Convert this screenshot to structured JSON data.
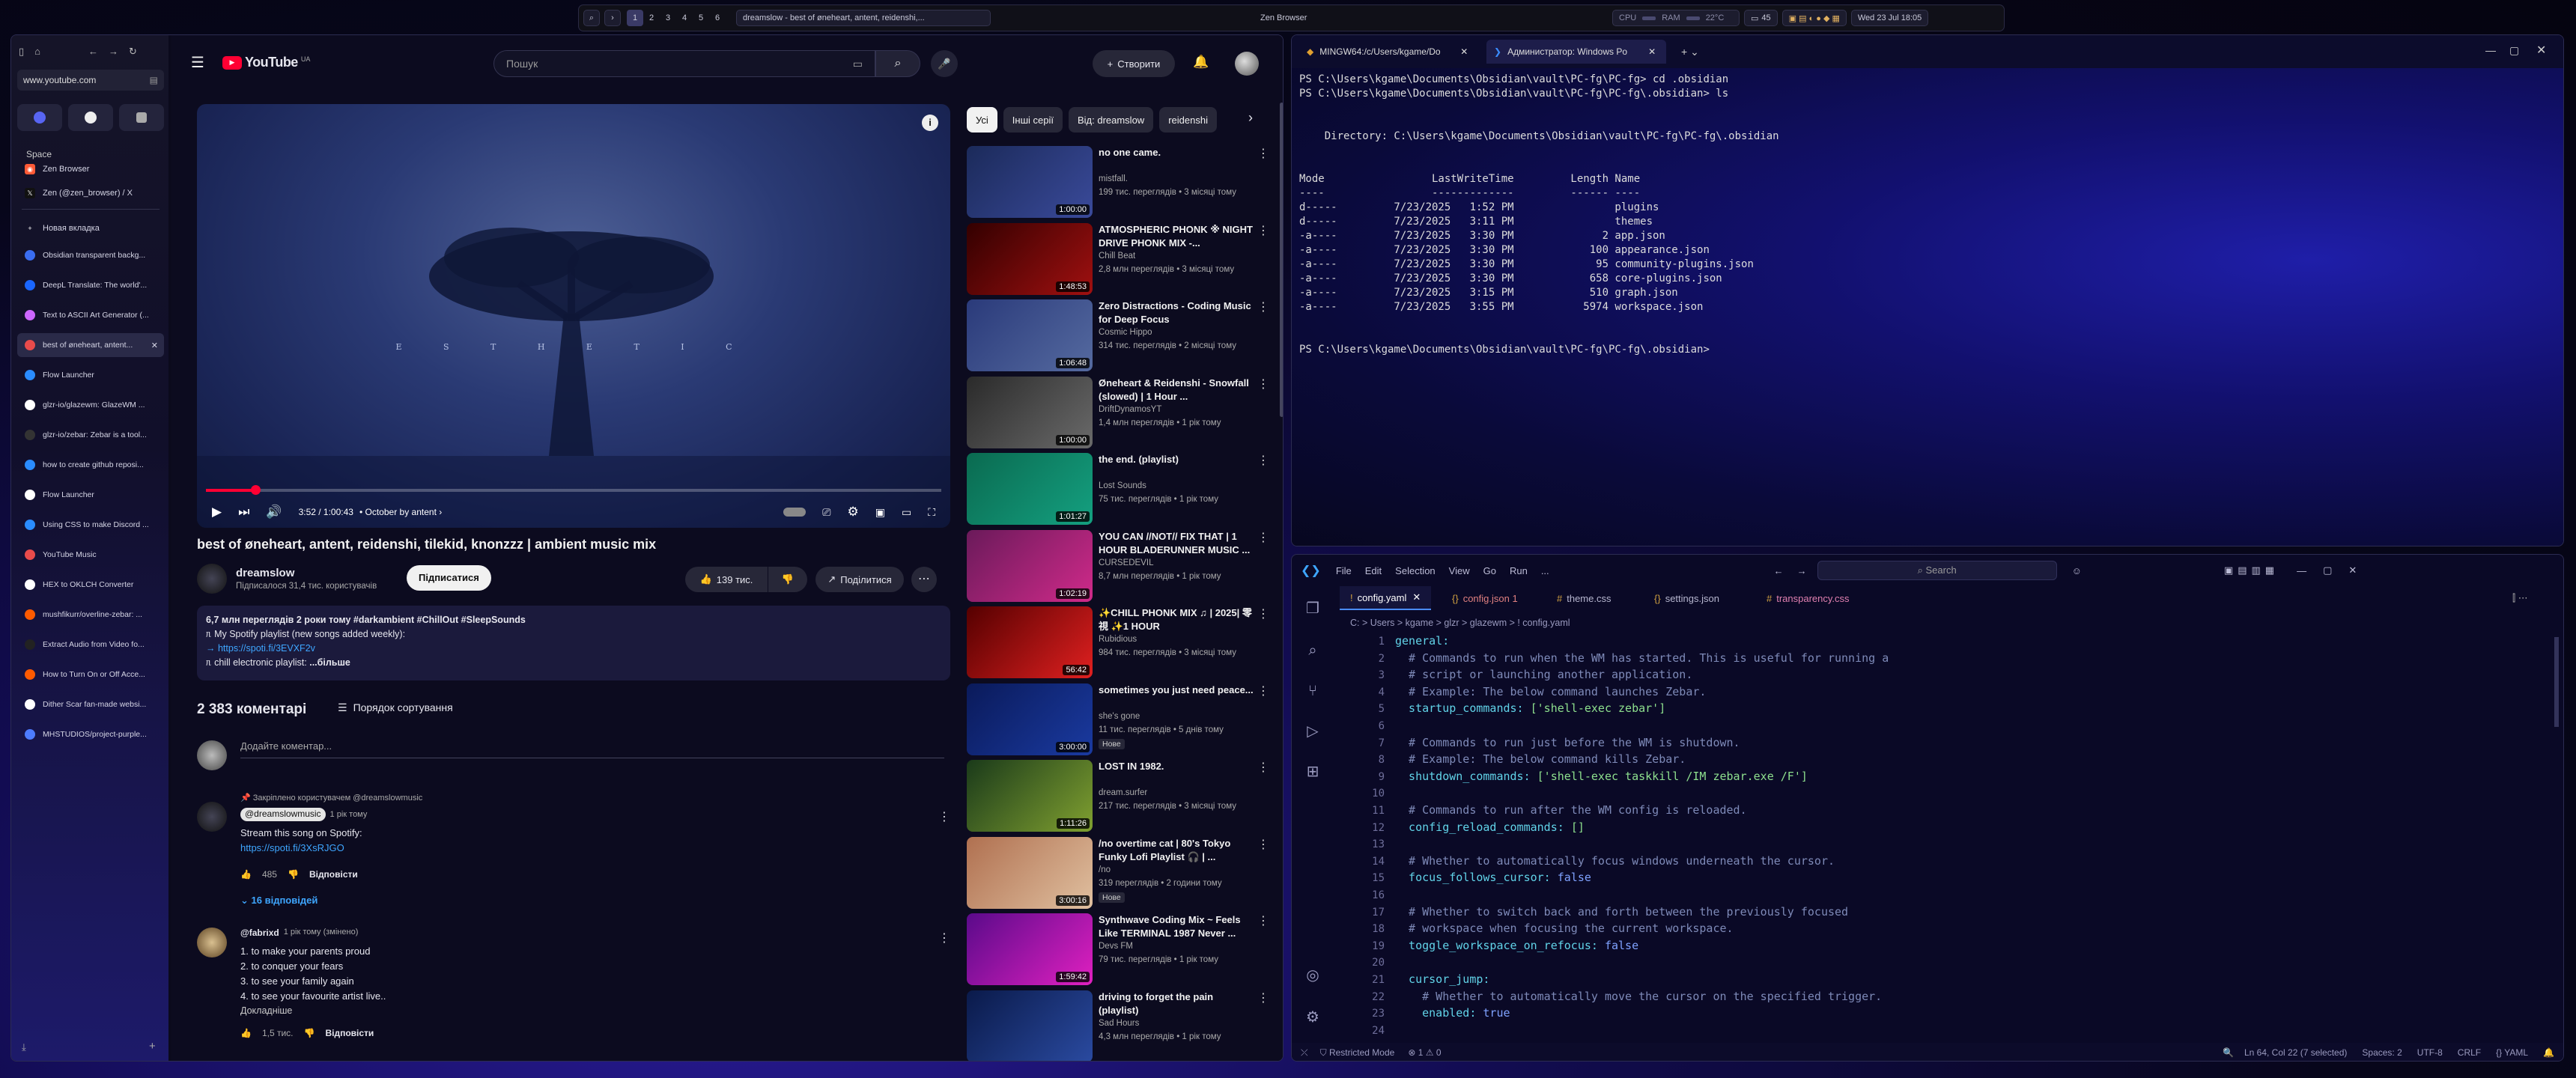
{
  "topbar": {
    "app_title": "Zen Browser",
    "workspaces": [
      "1",
      "2",
      "3",
      "4",
      "5",
      "6"
    ],
    "active_window": "dreamslow - best of øneheart, antent, reidenshi,...",
    "cpu_label": "CPU",
    "ram_label": "RAM",
    "temp": "22°C",
    "battery": "45",
    "datetime": "Wed 23 Jul 18:05"
  },
  "browser": {
    "url": "www.youtube.com",
    "space_label": "Space",
    "pinned": [
      "Zen Browser",
      "Zen (@zen_browser) / X"
    ],
    "new_tab": "Новая вкладка",
    "tabs": [
      "Obsidian transparent backg...",
      "DeepL Translate: The world'...",
      "Text to ASCII Art Generator (...",
      "best of øneheart, antent...",
      "Flow Launcher",
      "glzr-io/glazewm: GlazeWM ...",
      "glzr-io/zebar: Zebar is a tool...",
      "how to create github reposi...",
      "Flow Launcher",
      "Using CSS to make Discord ...",
      "YouTube Music",
      "HEX to OKLCH Converter",
      "mushfikurr/overline-zebar: ...",
      "Extract Audio from Video fo...",
      "How to Turn On or Off Acce...",
      "Dither Scar fan-made websi...",
      "MHSTUDIOS/project-purple..."
    ]
  },
  "youtube": {
    "logo": "YouTube",
    "region": "UA",
    "search_placeholder": "Пошук",
    "create_label": "Створити",
    "video": {
      "overlay_text": "E  S  T  H  E  T  I  C",
      "time": "3:52 / 1:00:43",
      "chapter": "October by antent",
      "title": "best of øneheart, antent, reidenshi, tilekid, knonzzz | ambient music mix",
      "channel": "dreamslow",
      "subscribers": "Підписалося 31,4 тис. користувачів",
      "subscribe": "Підписатися",
      "likes": "139 тис.",
      "share": "Поділитися",
      "desc_stats": "6,7 млн переглядів  2 роки тому  #darkambient #ChillOut #SleepSounds",
      "desc_line1": "ᥰ My Spotify playlist (new songs added weekly):",
      "desc_link": "→ https://spoti.fi/3EVXF2v",
      "desc_line3": "ᥰ chill electronic playlist:",
      "desc_more": "...більше"
    },
    "comments": {
      "count": "2 383 коментарі",
      "sort": "Порядок сортування",
      "add_placeholder": "Додайте коментар...",
      "pinned_by": "Закріплено користувачем @dreamslowmusic",
      "c1_author": "@dreamslowmusic",
      "c1_time": "1 рік тому",
      "c1_text": "Stream this song on Spotify:",
      "c1_link": "https://spoti.fi/3XsRJGO",
      "c1_likes": "485",
      "reply": "Відповісти",
      "c1_replies": "16 відповідей",
      "c2_author": "@fabrixd",
      "c2_time": "1 рік тому (змінено)",
      "c2_lines": [
        "1. to make your parents proud",
        "2. to conquer your fears",
        "3. to see your family again",
        "4. to see your favourite artist live.."
      ],
      "c2_more": "Докладніше",
      "c2_likes": "1,5 тис."
    },
    "chips": [
      "Усі",
      "Інші серії",
      "Від: dreamslow",
      "reidenshi"
    ],
    "recs": [
      {
        "title": "no one came.",
        "channel": "mistfall.",
        "views": "199 тис. переглядів • 3 місяці тому",
        "dur": "1:00:00"
      },
      {
        "title": "ATMOSPHERIC PHONK ※ NIGHT DRIVE PHONK MIX -...",
        "channel": "Chill Beat",
        "views": "2,8 млн переглядів • 3 місяці тому",
        "dur": "1:48:53"
      },
      {
        "title": "Zero Distractions - Coding Music for Deep Focus",
        "channel": "Cosmic Hippo",
        "views": "314 тис. переглядів • 2 місяці тому",
        "dur": "1:06:48"
      },
      {
        "title": "Øneheart & Reidenshi - Snowfall (slowed) | 1 Hour ...",
        "channel": "DriftDynamosYT",
        "views": "1,4 млн переглядів • 1 рік тому",
        "dur": "1:00:00"
      },
      {
        "title": "the end. (playlist)",
        "channel": "Lost Sounds",
        "views": "75 тис. переглядів • 1 рік тому",
        "dur": "1:01:27"
      },
      {
        "title": "YOU CAN //NOT// FIX THAT | 1 HOUR BLADERUNNER MUSIC ...",
        "channel": "CURSEDEVIL",
        "views": "8,7 млн переглядів • 1 рік тому",
        "dur": "1:02:19"
      },
      {
        "title": "✨CHILL PHONK MIX ♫ | 2025| 零視 ✨1 HOUR",
        "channel": "Rubidious",
        "views": "984 тис. переглядів • 3 місяці тому",
        "dur": "56:42"
      },
      {
        "title": "sometimes you just need peace...",
        "channel": "she's gone",
        "views": "11 тис. переглядів • 5 днів тому",
        "dur": "3:00:00",
        "new": "Нове"
      },
      {
        "title": "LOST IN 1982.",
        "channel": "dream.surfer",
        "views": "217 тис. переглядів • 3 місяці тому",
        "dur": "1:11:26"
      },
      {
        "title": "/no overtime cat | 80's Tokyo Funky Lofi Playlist 🎧 | ...",
        "channel": "/no",
        "views": "319 переглядів • 2 години тому",
        "dur": "3:00:16",
        "new": "Нове"
      },
      {
        "title": "Synthwave Coding Mix ~ Feels Like TERMINAL 1987 Never ...",
        "channel": "Devs FM",
        "views": "79 тис. переглядів • 1 рік тому",
        "dur": "1:59:42"
      },
      {
        "title": "driving to forget the pain (playlist)",
        "channel": "Sad Hours",
        "views": "4,3 млн переглядів • 1 рік тому",
        "dur": ""
      }
    ]
  },
  "terminal": {
    "tabs": [
      "MINGW64:/c/Users/kgame/Do",
      "Администратор: Windows Po"
    ],
    "lines": [
      "PS C:\\Users\\kgame\\Documents\\Obsidian\\vault\\PC-fg\\PC-fg> cd .obsidian",
      "PS C:\\Users\\kgame\\Documents\\Obsidian\\vault\\PC-fg\\PC-fg\\.obsidian> ls",
      "",
      "",
      "    Directory: C:\\Users\\kgame\\Documents\\Obsidian\\vault\\PC-fg\\PC-fg\\.obsidian",
      "",
      "",
      "Mode                 LastWriteTime         Length Name",
      "----                 -------------         ------ ----",
      "d-----         7/23/2025   1:52 PM                plugins",
      "d-----         7/23/2025   3:11 PM                themes",
      "-a----         7/23/2025   3:30 PM              2 app.json",
      "-a----         7/23/2025   3:30 PM            100 appearance.json",
      "-a----         7/23/2025   3:30 PM             95 community-plugins.json",
      "-a----         7/23/2025   3:30 PM            658 core-plugins.json",
      "-a----         7/23/2025   3:15 PM            510 graph.json",
      "-a----         7/23/2025   3:55 PM           5974 workspace.json",
      "",
      "",
      "PS C:\\Users\\kgame\\Documents\\Obsidian\\vault\\PC-fg\\PC-fg\\.obsidian>"
    ]
  },
  "vscode": {
    "menu": [
      "File",
      "Edit",
      "Selection",
      "View",
      "Go",
      "Run",
      "..."
    ],
    "search": "Search",
    "tabs": [
      "config.yaml",
      "config.json 1",
      "theme.css",
      "settings.json",
      "transparency.css"
    ],
    "breadcrumb": "C: > Users > kgame > glzr > glazewm > ! config.yaml",
    "code": [
      [
        [
          "ky",
          "general:"
        ]
      ],
      [
        [
          "cm",
          "  # Commands to run when the WM has started. This is useful for running a"
        ]
      ],
      [
        [
          "cm",
          "  # script or launching another application."
        ]
      ],
      [
        [
          "cm",
          "  # Example: The below command launches Zebar."
        ]
      ],
      [
        [
          "ky",
          "  startup_commands: "
        ],
        [
          "st",
          "['shell-exec zebar']"
        ]
      ],
      [],
      [
        [
          "cm",
          "  # Commands to run just before the WM is shutdown."
        ]
      ],
      [
        [
          "cm",
          "  # Example: The below command kills Zebar."
        ]
      ],
      [
        [
          "ky",
          "  shutdown_commands: "
        ],
        [
          "st",
          "['shell-exec taskkill /IM zebar.exe /F']"
        ]
      ],
      [],
      [
        [
          "cm",
          "  # Commands to run after the WM config is reloaded."
        ]
      ],
      [
        [
          "ky",
          "  config_reload_commands: "
        ],
        [
          "st",
          "[]"
        ]
      ],
      [],
      [
        [
          "cm",
          "  # Whether to automatically focus windows underneath the cursor."
        ]
      ],
      [
        [
          "ky",
          "  focus_follows_cursor: "
        ],
        [
          "bo",
          "false"
        ]
      ],
      [],
      [
        [
          "cm",
          "  # Whether to switch back and forth between the previously focused"
        ]
      ],
      [
        [
          "cm",
          "  # workspace when focusing the current workspace."
        ]
      ],
      [
        [
          "ky",
          "  toggle_workspace_on_refocus: "
        ],
        [
          "bo",
          "false"
        ]
      ],
      [],
      [
        [
          "ky",
          "  cursor_jump:"
        ]
      ],
      [
        [
          "cm",
          "    # Whether to automatically move the cursor on the specified trigger."
        ]
      ],
      [
        [
          "ky",
          "    enabled: "
        ],
        [
          "bo",
          "true"
        ]
      ],
      []
    ],
    "status": {
      "mode": "Restricted Mode",
      "problems": "⊗ 1 ⚠ 0",
      "position": "Ln 64, Col 22 (7 selected)",
      "spaces": "Spaces: 2",
      "encoding": "UTF-8",
      "eol": "CRLF",
      "lang": "{} YAML"
    }
  }
}
